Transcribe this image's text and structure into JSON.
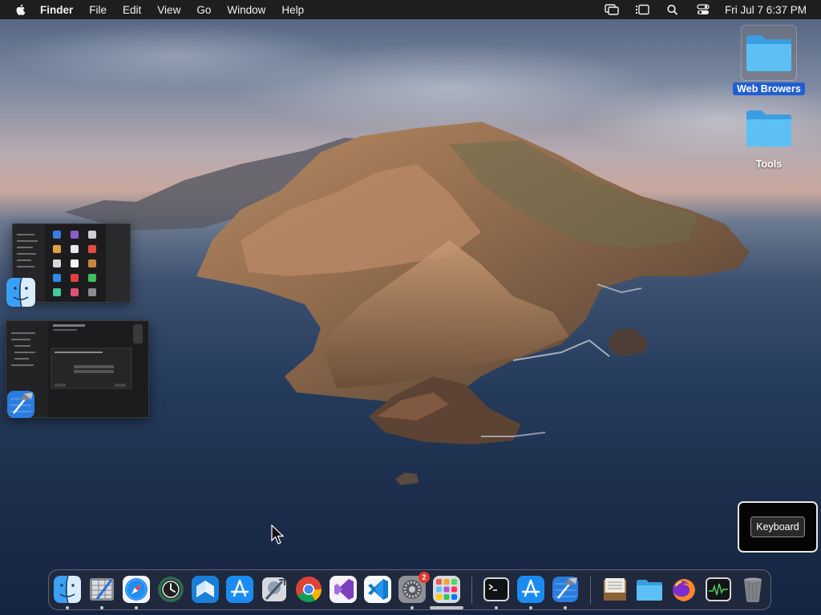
{
  "menubar": {
    "app_name": "Finder",
    "items": [
      "File",
      "Edit",
      "View",
      "Go",
      "Window",
      "Help"
    ],
    "status_icons": [
      "screen-mirroring-icon",
      "stage-manager-icon",
      "spotlight-search-icon",
      "control-center-icon"
    ],
    "clock": "Fri Jul 7  6:37 PM"
  },
  "desktop": {
    "folders": [
      {
        "label": "Web Browers",
        "selected": true
      },
      {
        "label": "Tools",
        "selected": false
      }
    ],
    "window_thumbnails": [
      {
        "app": "Finder",
        "icon": "finder-icon"
      },
      {
        "app": "Xcode",
        "icon": "xcode-icon"
      }
    ]
  },
  "keyboard_popup": {
    "button_label": "Keyboard"
  },
  "dock": {
    "items": [
      {
        "name": "Finder",
        "icon": "finder-icon",
        "running": true
      },
      {
        "name": "Script Editor",
        "icon": "script-editor-icon",
        "running": true
      },
      {
        "name": "Safari",
        "icon": "safari-icon",
        "running": true
      },
      {
        "name": "Time Machine",
        "icon": "time-machine-icon",
        "running": false
      },
      {
        "name": "Microsoft Remote Desktop",
        "icon": "remote-desktop-icon",
        "running": false
      },
      {
        "name": "App Store",
        "icon": "app-store-icon",
        "running": false
      },
      {
        "name": "Directory Utility",
        "icon": "directory-utility-icon",
        "running": false
      },
      {
        "name": "Google Chrome",
        "icon": "chrome-icon",
        "running": false
      },
      {
        "name": "Visual Studio",
        "icon": "visual-studio-icon",
        "running": false
      },
      {
        "name": "Visual Studio Code",
        "icon": "vscode-icon",
        "running": false
      },
      {
        "name": "System Preferences",
        "icon": "system-preferences-icon",
        "running": true,
        "badge": "2"
      },
      {
        "name": "Launchpad",
        "icon": "launchpad-icon",
        "running": false
      },
      {
        "name": "Terminal",
        "icon": "terminal-icon",
        "running": true
      },
      {
        "name": "App Store",
        "icon": "app-store-icon-2",
        "running": true
      },
      {
        "name": "Xcode",
        "icon": "xcode-icon",
        "running": true
      },
      {
        "name": "Archive Utility",
        "icon": "archive-icon",
        "running": false
      },
      {
        "name": "Downloads",
        "icon": "folder-icon",
        "running": false
      },
      {
        "name": "Firefox",
        "icon": "firefox-icon",
        "running": false
      },
      {
        "name": "Activity Monitor",
        "icon": "activity-monitor-icon",
        "running": false
      },
      {
        "name": "Trash",
        "icon": "trash-icon",
        "running": false
      }
    ]
  },
  "colors": {
    "selection_blue": "#1f5fd1",
    "folder_blue": "#4fb3f2",
    "menubar_bg": "#1e1e1f",
    "badge_red": "#e8372c"
  }
}
